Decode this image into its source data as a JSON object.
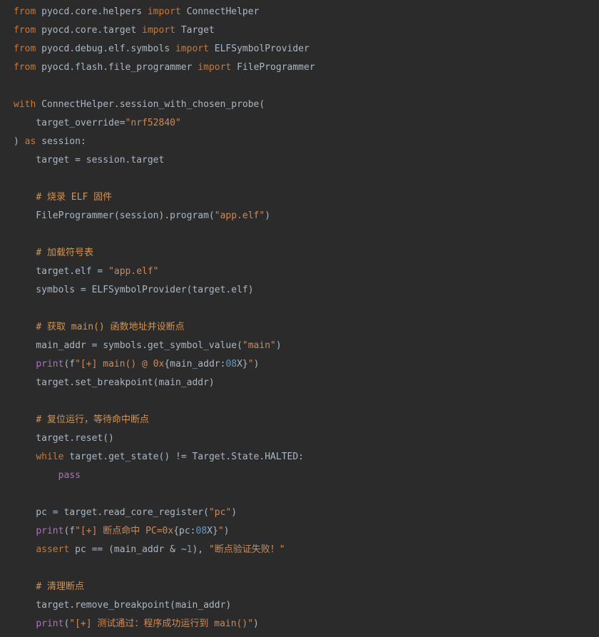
{
  "colors": {
    "background": "#2b2b2b",
    "plain": "#a9b7c6",
    "keyword": "#cc7832",
    "string": "#cc8a5a",
    "number": "#6897bb",
    "builtin": "#b070c0",
    "comment": "#d49350"
  },
  "code": {
    "lines": [
      [
        [
          "from",
          "kw"
        ],
        [
          " pyocd.core.helpers ",
          "plain"
        ],
        [
          "import",
          "kw"
        ],
        [
          " ConnectHelper",
          "plain"
        ]
      ],
      [
        [
          "from",
          "kw"
        ],
        [
          " pyocd.core.target ",
          "plain"
        ],
        [
          "import",
          "kw"
        ],
        [
          " Target",
          "plain"
        ]
      ],
      [
        [
          "from",
          "kw"
        ],
        [
          " pyocd.debug.elf.symbols ",
          "plain"
        ],
        [
          "import",
          "kw"
        ],
        [
          " ELFSymbolProvider",
          "plain"
        ]
      ],
      [
        [
          "from",
          "kw"
        ],
        [
          " pyocd.flash.file_programmer ",
          "plain"
        ],
        [
          "import",
          "kw"
        ],
        [
          " FileProgrammer",
          "plain"
        ]
      ],
      [],
      [
        [
          "with",
          "kw"
        ],
        [
          " ConnectHelper.session_with_chosen_probe(",
          "plain"
        ]
      ],
      [
        [
          "    target_override=",
          "plain"
        ],
        [
          "\"nrf52840\"",
          "str"
        ]
      ],
      [
        [
          ") ",
          "plain"
        ],
        [
          "as",
          "kw"
        ],
        [
          " session:",
          "plain"
        ]
      ],
      [
        [
          "    target = session.target",
          "plain"
        ]
      ],
      [],
      [
        [
          "    ",
          "plain"
        ],
        [
          "# 烧录 ELF 固件",
          "comment"
        ]
      ],
      [
        [
          "    FileProgrammer(session).program(",
          "plain"
        ],
        [
          "\"app.elf\"",
          "str"
        ],
        [
          ")",
          "plain"
        ]
      ],
      [],
      [
        [
          "    ",
          "plain"
        ],
        [
          "# 加载符号表",
          "comment"
        ]
      ],
      [
        [
          "    target.elf = ",
          "plain"
        ],
        [
          "\"app.elf\"",
          "str"
        ]
      ],
      [
        [
          "    symbols = ELFSymbolProvider(target.elf)",
          "plain"
        ]
      ],
      [],
      [
        [
          "    ",
          "plain"
        ],
        [
          "# 获取 main() 函数地址并设断点",
          "comment"
        ]
      ],
      [
        [
          "    main_addr = symbols.get_symbol_value(",
          "plain"
        ],
        [
          "\"main\"",
          "str"
        ],
        [
          ")",
          "plain"
        ]
      ],
      [
        [
          "    ",
          "plain"
        ],
        [
          "print",
          "builtin"
        ],
        [
          "(f",
          "plain"
        ],
        [
          "\"[+] main() @ 0x",
          "str"
        ],
        [
          "{main_addr:",
          "plain"
        ],
        [
          "08",
          "num"
        ],
        [
          "X}",
          "plain"
        ],
        [
          "\"",
          "str"
        ],
        [
          ")",
          "plain"
        ]
      ],
      [
        [
          "    target.set_breakpoint(main_addr)",
          "plain"
        ]
      ],
      [],
      [
        [
          "    ",
          "plain"
        ],
        [
          "# 复位运行，等待命中断点",
          "comment"
        ]
      ],
      [
        [
          "    target.reset()",
          "plain"
        ]
      ],
      [
        [
          "    ",
          "plain"
        ],
        [
          "while",
          "kw"
        ],
        [
          " target.get_state() != Target.State.HALTED:",
          "plain"
        ]
      ],
      [
        [
          "        ",
          "plain"
        ],
        [
          "pass",
          "builtin"
        ]
      ],
      [],
      [
        [
          "    pc = target.read_core_register(",
          "plain"
        ],
        [
          "\"pc\"",
          "str"
        ],
        [
          ")",
          "plain"
        ]
      ],
      [
        [
          "    ",
          "plain"
        ],
        [
          "print",
          "builtin"
        ],
        [
          "(f",
          "plain"
        ],
        [
          "\"[+] 断点命中 PC=0x",
          "str"
        ],
        [
          "{pc:",
          "plain"
        ],
        [
          "08",
          "num"
        ],
        [
          "X}",
          "plain"
        ],
        [
          "\"",
          "str"
        ],
        [
          ")",
          "plain"
        ]
      ],
      [
        [
          "    ",
          "plain"
        ],
        [
          "assert",
          "kw"
        ],
        [
          " pc == (main_addr & ~",
          "plain"
        ],
        [
          "1",
          "num"
        ],
        [
          "), ",
          "plain"
        ],
        [
          "\"断点验证失败！\"",
          "str"
        ]
      ],
      [],
      [
        [
          "    ",
          "plain"
        ],
        [
          "# 清理断点",
          "comment"
        ]
      ],
      [
        [
          "    target.remove_breakpoint(main_addr)",
          "plain"
        ]
      ],
      [
        [
          "    ",
          "plain"
        ],
        [
          "print",
          "builtin"
        ],
        [
          "(",
          "plain"
        ],
        [
          "\"[+] 测试通过：程序成功运行到 main()\"",
          "str"
        ],
        [
          ")",
          "plain"
        ]
      ]
    ]
  }
}
